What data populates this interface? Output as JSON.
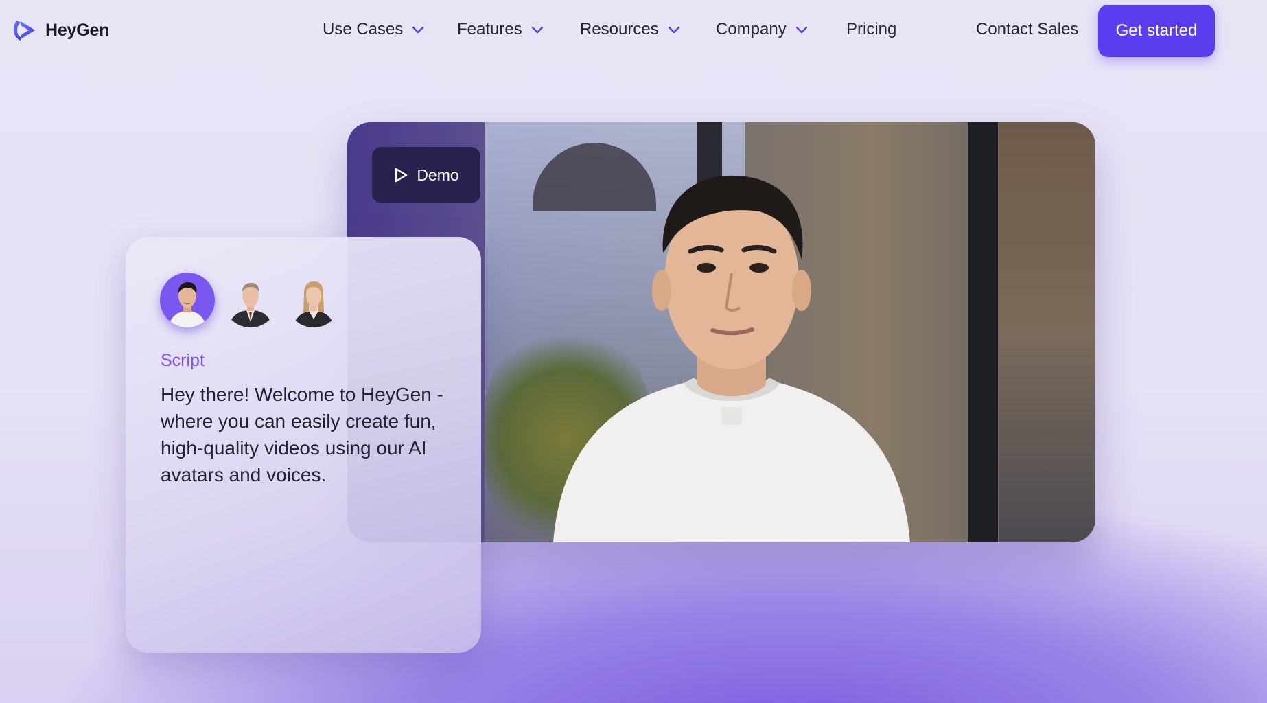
{
  "brand": {
    "name": "HeyGen",
    "logo_icon": "heygen-logo-icon",
    "accent": "#5b3df0"
  },
  "nav": {
    "items": [
      {
        "label": "Use Cases",
        "dropdown": true
      },
      {
        "label": "Features",
        "dropdown": true
      },
      {
        "label": "Resources",
        "dropdown": true
      },
      {
        "label": "Company",
        "dropdown": true
      },
      {
        "label": "Pricing",
        "dropdown": false
      }
    ],
    "contact": "Contact Sales",
    "cta": "Get started"
  },
  "video": {
    "demo_label": "Demo",
    "play_icon": "play-icon"
  },
  "script_card": {
    "label": "Script",
    "text": "Hey there! Welcome to HeyGen - where you can easily create fun, high-quality videos using our AI avatars and voices.",
    "avatars": [
      "avatar-asian-man",
      "avatar-man-suit",
      "avatar-woman-blonde"
    ],
    "selected_avatar": 0
  }
}
